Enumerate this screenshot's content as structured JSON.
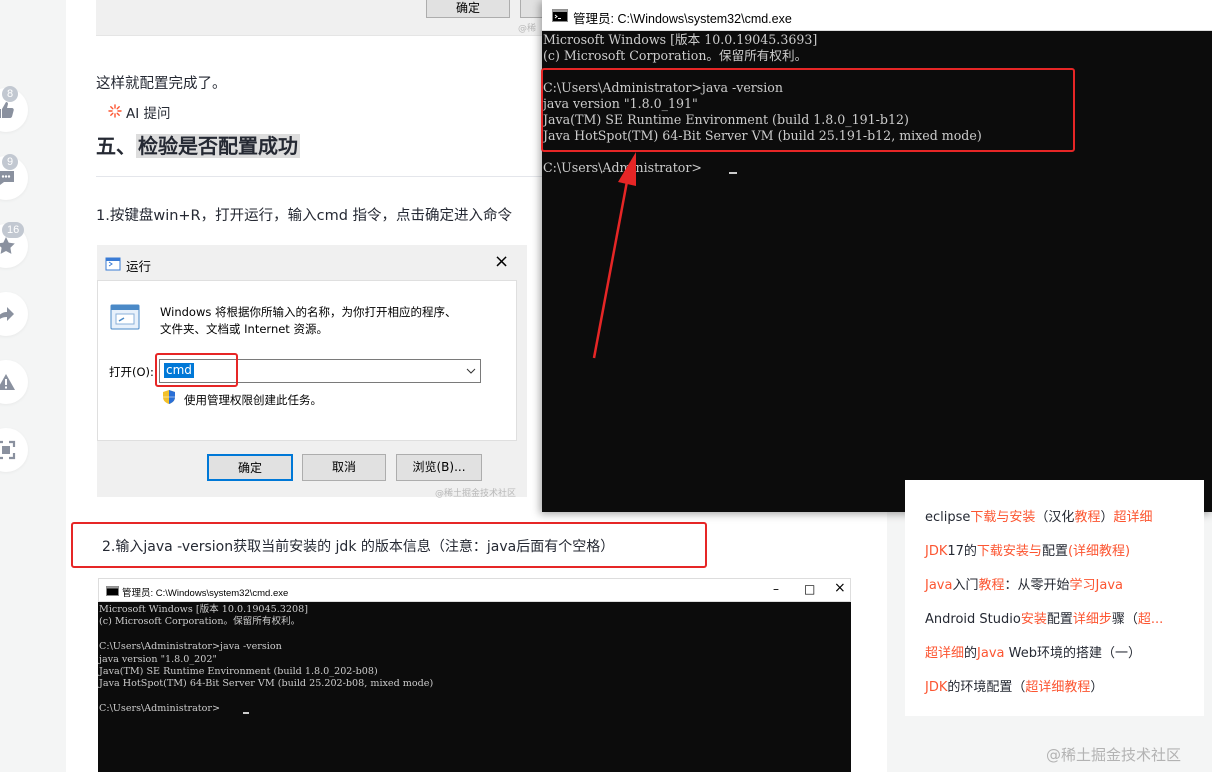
{
  "actions": [
    {
      "name": "like",
      "count": "8"
    },
    {
      "name": "comment",
      "count": "9"
    },
    {
      "name": "collect",
      "count": "16"
    },
    {
      "name": "share"
    },
    {
      "name": "report"
    },
    {
      "name": "fullscreen"
    }
  ],
  "article": {
    "top_button": "确定",
    "top_watermark": "@稀",
    "config_done": "这样就配置完成了。",
    "ai_button": "AI 提问",
    "section_num": "五、",
    "section_title": "检验是否配置成功",
    "step1": "1.按键盘win+R，打开运行，输入cmd 指令，点击确定进入命令",
    "step2": "2.输入java -version获取当前安装的 jdk 的版本信息（注意：java后面有个空格）"
  },
  "run_dialog": {
    "title": "运行",
    "close": "×",
    "desc_line1": "Windows 将根据你所输入的名称，为你打开相应的程序、",
    "desc_line2": "文件夹、文档或 Internet 资源。",
    "open_label": "打开(O):",
    "input_value": "cmd",
    "admin_note": "使用管理权限创建此任务。",
    "ok": "确定",
    "cancel": "取消",
    "browse": "浏览(B)...",
    "watermark": "@稀土掘金技术社区"
  },
  "cmd_main": {
    "title": "管理员: C:\\Windows\\system32\\cmd.exe",
    "lines": [
      "Microsoft Windows [版本 10.0.19045.3693]",
      "(c) Microsoft Corporation。保留所有权利。",
      "",
      "C:\\Users\\Administrator>java -version",
      "java version \"1.8.0_191\"",
      "Java(TM) SE Runtime Environment (build 1.8.0_191-b12)",
      "Java HotSpot(TM) 64-Bit Server VM (build 25.191-b12, mixed mode)",
      "",
      "C:\\Users\\Administrator>"
    ]
  },
  "cmd_small": {
    "title": "管理员: C:\\Windows\\system32\\cmd.exe",
    "minimize": "–",
    "maximize": "□",
    "close": "×",
    "lines": [
      "Microsoft Windows [版本 10.0.19045.3208]",
      "(c) Microsoft Corporation。保留所有权利。",
      "",
      "C:\\Users\\Administrator>java -version",
      "java version \"1.8.0_202\"",
      "Java(TM) SE Runtime Environment (build 1.8.0_202-b08)",
      "Java HotSpot(TM) 64-Bit Server VM (build 25.202-b08, mixed mode)",
      "",
      "C:\\Users\\Administrator>"
    ]
  },
  "sidebar": {
    "links": [
      [
        {
          "t": "eclipse"
        },
        {
          "t": "下载与安装",
          "h": true
        },
        {
          "t": "（汉化"
        },
        {
          "t": "教程",
          "h": true
        },
        {
          "t": "）"
        },
        {
          "t": "超详细",
          "h": true
        }
      ],
      [
        {
          "t": "JDK",
          "h": true
        },
        {
          "t": "17的"
        },
        {
          "t": "下载安装与",
          "h": true
        },
        {
          "t": "配置"
        },
        {
          "t": "(详细教程)",
          "h": true
        }
      ],
      [
        {
          "t": "Java",
          "h": true
        },
        {
          "t": "入门"
        },
        {
          "t": "教程",
          "h": true
        },
        {
          "t": "：从零开始"
        },
        {
          "t": "学习Java",
          "h": true
        }
      ],
      [
        {
          "t": "Android Studio"
        },
        {
          "t": "安装",
          "h": true
        },
        {
          "t": "配置"
        },
        {
          "t": "详细步",
          "h": true
        },
        {
          "t": "骤（"
        },
        {
          "t": "超...",
          "h": true
        }
      ],
      [
        {
          "t": "超详细",
          "h": true
        },
        {
          "t": "的"
        },
        {
          "t": "Java",
          "h": true
        },
        {
          "t": " Web环境的搭建（一）"
        }
      ],
      [
        {
          "t": "JDK",
          "h": true
        },
        {
          "t": "的环境配置（"
        },
        {
          "t": "超详细教程",
          "h": true
        },
        {
          "t": "）"
        }
      ]
    ]
  },
  "watermark": "@稀土掘金技术社区",
  "colors": {
    "accent": "#fc5531",
    "annotation": "#e62626",
    "terminal_bg": "#0c0c0c",
    "terminal_fg": "#cccccc"
  }
}
